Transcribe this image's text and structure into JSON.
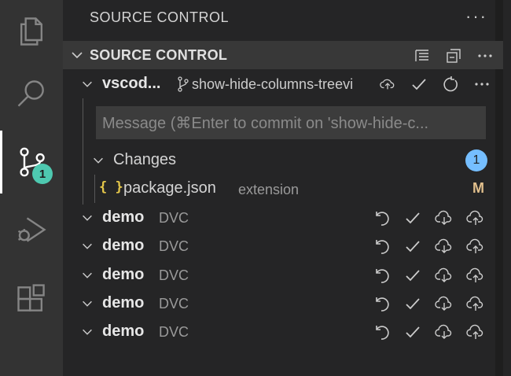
{
  "activity_bar": {
    "items": [
      {
        "name": "explorer",
        "icon": "files-icon"
      },
      {
        "name": "search",
        "icon": "search-icon"
      },
      {
        "name": "source-control",
        "icon": "source-control-icon",
        "badge": "1",
        "active": true
      },
      {
        "name": "run-and-debug",
        "icon": "debug-icon"
      },
      {
        "name": "extensions",
        "icon": "extensions-icon"
      }
    ]
  },
  "sidebar": {
    "title": "SOURCE CONTROL",
    "more": "···",
    "section_title": "SOURCE CONTROL",
    "repo": {
      "name": "vscod...",
      "branch": "show-hide-columns-treevi"
    },
    "commit_placeholder": "Message (⌘Enter to commit on 'show-hide-c...",
    "changes": {
      "label": "Changes",
      "count": "1",
      "files": [
        {
          "icon": "{ }",
          "name": "package.json",
          "dir": "extension",
          "status": "M"
        }
      ]
    },
    "dvc_repos": [
      {
        "name": "demo",
        "kind": "DVC"
      },
      {
        "name": "demo",
        "kind": "DVC"
      },
      {
        "name": "demo",
        "kind": "DVC"
      },
      {
        "name": "demo",
        "kind": "DVC"
      },
      {
        "name": "demo",
        "kind": "DVC"
      }
    ]
  },
  "colors": {
    "activity_bar_bg": "#333333",
    "sidebar_bg": "#252526",
    "badge_teal": "#4ec9b0",
    "badge_blue": "#75beff",
    "modified": "#e2c08d"
  }
}
